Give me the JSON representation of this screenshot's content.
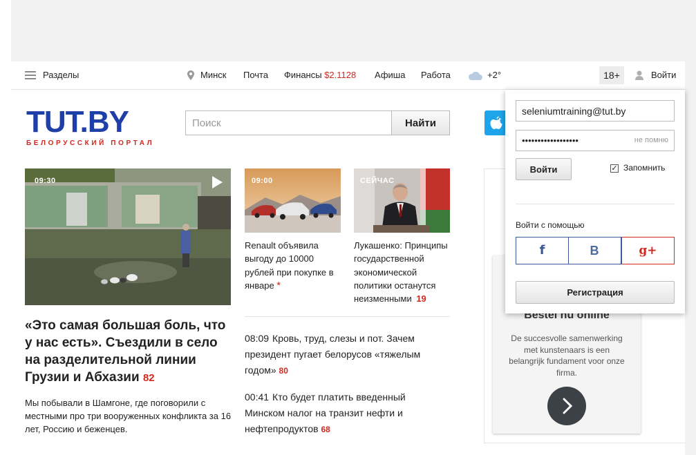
{
  "topbar": {
    "sections_label": "Разделы",
    "city": "Минск",
    "mail": "Почта",
    "finance_label": "Финансы",
    "finance_value": "$2.1128",
    "afisha": "Афиша",
    "jobs": "Работа",
    "weather": "+2°",
    "age_rating": "18+",
    "login": "Войти"
  },
  "logo": {
    "main": "TUT.BY",
    "subtitle": "БЕЛОРУССКИЙ ПОРТАЛ"
  },
  "search": {
    "placeholder": "Поиск",
    "button": "Найти"
  },
  "main_story": {
    "duration": "09:30",
    "title": "«Это самая большая боль, что у нас есть». Съездили в село на разделительной линии Грузии и Абхазии",
    "comments": "82",
    "lead": "Мы побывали в Шамгоне, где поговорили с местными про три вооруженных конфликта за 16 лет, Россию и беженцев."
  },
  "cards": [
    {
      "badge": "09:00",
      "title": "Renault объявила выгоду до 10000 рублей при покупке в январе",
      "mark": "*"
    },
    {
      "badge": "СЕЙЧАС",
      "title": "Лукашенко: Принципы государственной экономической политики останутся неизменными",
      "comments": "19"
    }
  ],
  "news": [
    {
      "time": "08:09",
      "title": "Кровь, труд, слезы и пот. Зачем президент пугает белорусов «тяжелым годом»",
      "comments": "80"
    },
    {
      "time": "00:41",
      "title": "Кто будет платить введенный Минском налог на транзит нефти и нефтепродуктов",
      "comments": "68"
    }
  ],
  "banner": {
    "title": "Bestel nu online",
    "text": "De succesvolle samenwerking met kunstenaars is een belangrijk fundament voor onze firma."
  },
  "login_popup": {
    "email": "seleniumtraining@tut.by",
    "password_mask": "••••••••••••••••••",
    "forgot": "не помню",
    "submit": "Войти",
    "remember_label": "Запомнить",
    "remember_checked": "✓",
    "via_label": "Войти с помощью",
    "facebook": "f",
    "vk": "B",
    "google": "g+",
    "register": "Регистрация"
  },
  "colors": {
    "brand_blue": "#1e3ea8",
    "brand_red": "#d0281f",
    "facebook": "#3b5998",
    "google": "#d0281f"
  }
}
